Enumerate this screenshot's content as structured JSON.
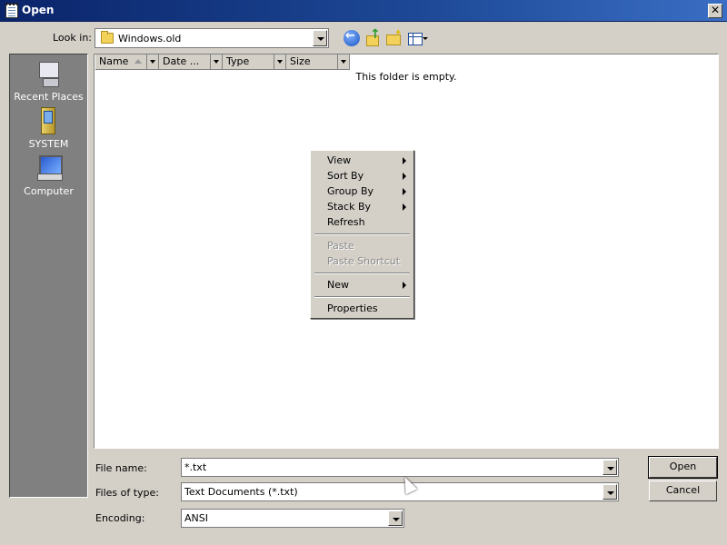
{
  "window": {
    "title": "Open"
  },
  "toolbar": {
    "look_in_label": "Look in:",
    "look_in_value": "Windows.old",
    "icons": [
      "back-icon",
      "up-folder-icon",
      "new-folder-icon",
      "views-menu-icon"
    ]
  },
  "places": [
    {
      "label": "Recent Places",
      "icon": "recent-places-icon"
    },
    {
      "label": "SYSTEM",
      "icon": "user-folder-icon"
    },
    {
      "label": "Computer",
      "icon": "computer-icon"
    }
  ],
  "list": {
    "columns": [
      "Name",
      "Date ...",
      "Type",
      "Size"
    ],
    "empty_message": "This folder is empty."
  },
  "context_menu": {
    "items": [
      {
        "label": "View",
        "submenu": true,
        "enabled": true
      },
      {
        "label": "Sort By",
        "submenu": true,
        "enabled": true
      },
      {
        "label": "Group By",
        "submenu": true,
        "enabled": true
      },
      {
        "label": "Stack By",
        "submenu": true,
        "enabled": true
      },
      {
        "label": "Refresh",
        "submenu": false,
        "enabled": true
      },
      {
        "label": "Paste",
        "submenu": false,
        "enabled": false
      },
      {
        "label": "Paste Shortcut",
        "submenu": false,
        "enabled": false
      },
      {
        "label": "New",
        "submenu": true,
        "enabled": true
      },
      {
        "label": "Properties",
        "submenu": false,
        "enabled": true
      }
    ]
  },
  "form": {
    "file_name_label": "File name:",
    "file_name_value": "*.txt",
    "files_of_type_label": "Files of type:",
    "files_of_type_value": "Text Documents (*.txt)",
    "encoding_label": "Encoding:",
    "encoding_value": "ANSI"
  },
  "buttons": {
    "open": "Open",
    "cancel": "Cancel"
  },
  "colors": {
    "titlebar": "#0a246a",
    "face": "#d4d0c8",
    "places_bg": "#808080"
  }
}
